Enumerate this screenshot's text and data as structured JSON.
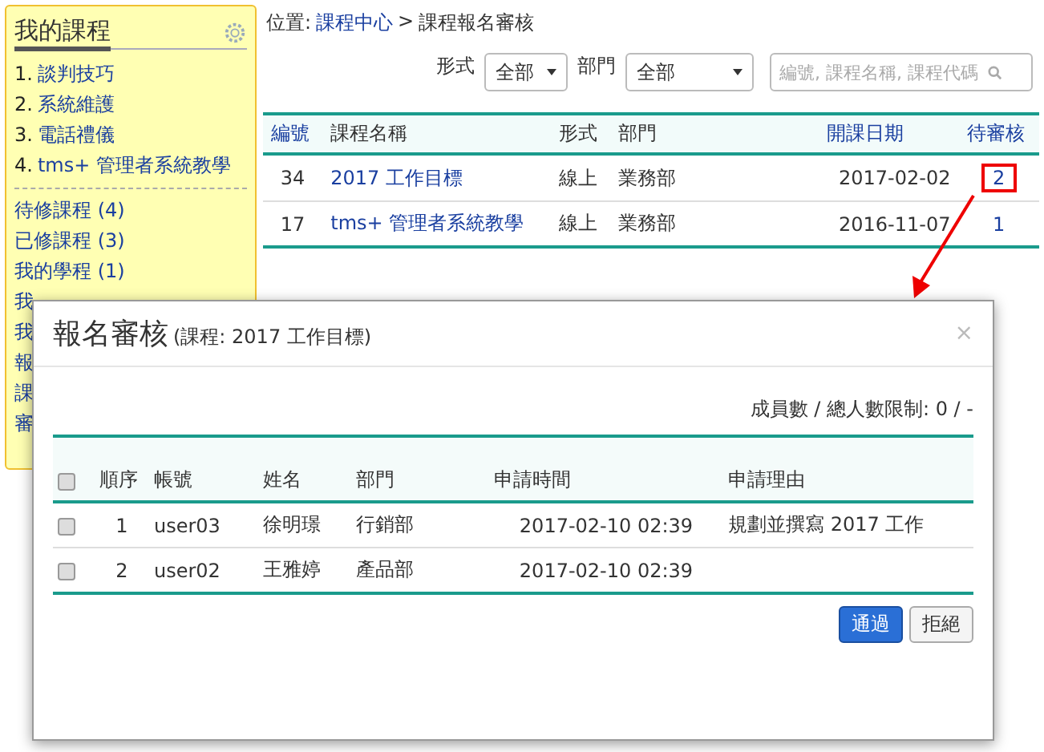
{
  "sidebar": {
    "title": "我的課程",
    "courses": [
      {
        "number": "1.",
        "name": "談判技巧"
      },
      {
        "number": "2.",
        "name": "系統維護"
      },
      {
        "number": "3.",
        "name": "電話禮儀"
      },
      {
        "number": "4.",
        "name": "tms+ 管理者系統教學"
      }
    ],
    "links": [
      "待修課程 (4)",
      "已修課程 (3)",
      "我的學程 (1)",
      "我",
      "我",
      "報",
      "課",
      "審"
    ]
  },
  "breadcrumb": {
    "label": "位置:",
    "link": "課程中心",
    "separator": ">",
    "current": "課程報名審核"
  },
  "filters": [
    {
      "label": "形式",
      "value": "全部"
    },
    {
      "label": "部門",
      "value": "全部"
    }
  ],
  "search": {
    "placeholder": "編號, 課程名稱, 課程代碼"
  },
  "table": {
    "columns": [
      "編號",
      "課程名稱",
      "形式",
      "部門",
      "開課日期",
      "待審核"
    ],
    "rows": [
      {
        "id": "34",
        "name": "2017 工作目標",
        "format": "線上",
        "dept": "業務部",
        "date": "2017-02-02",
        "pending": "2",
        "highlighted": true
      },
      {
        "id": "17",
        "name": "tms+ 管理者系統教學",
        "format": "線上",
        "dept": "業務部",
        "date": "2016-11-07",
        "pending": "1",
        "highlighted": false
      }
    ]
  },
  "modal": {
    "title": "報名審核",
    "subtitle": "(課程: 2017 工作目標)",
    "close": "×",
    "count": "成員數 / 總人數限制: 0 / -",
    "select_all": {
      "checked": false
    },
    "columns": [
      "順序",
      "帳號",
      "姓名",
      "部門",
      "申請時間",
      "申請理由"
    ],
    "rows": [
      {
        "checked": false,
        "order": "1",
        "account": "user03",
        "name": "徐明璟",
        "dept": "行銷部",
        "time": "2017-02-10 02:39",
        "reason": "規劃並撰寫 2017 工作"
      },
      {
        "checked": false,
        "order": "2",
        "account": "user02",
        "name": "王雅婷",
        "dept": "產品部",
        "time": "2017-02-10 02:39",
        "reason": ""
      }
    ],
    "buttons": [
      {
        "label": "通過",
        "kind": "primary"
      },
      {
        "label": "拒絕",
        "kind": "default"
      }
    ]
  }
}
